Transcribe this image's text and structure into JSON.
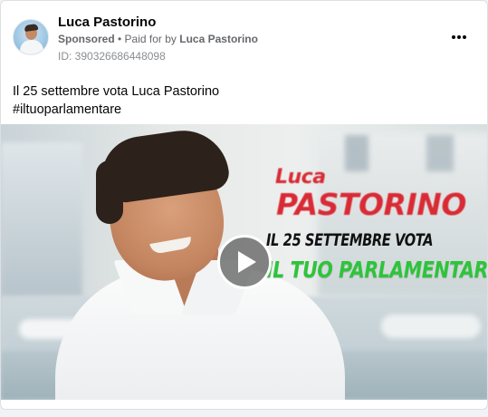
{
  "post": {
    "author_name": "Luca Pastorino",
    "sponsored_label": "Sponsored",
    "separator": " • ",
    "paid_for_prefix": "Paid for by ",
    "paid_for_by": "Luca Pastorino",
    "ad_id_label": "ID: 390326686448098",
    "text_line1": "Il 25 settembre vota Luca Pastorino",
    "hashtag": "#iltuoparlamentare",
    "more_icon": "more-horizontal-icon"
  },
  "media": {
    "overlay_name_small": "Luca",
    "overlay_name_big": "PASTORINO",
    "overlay_line1": "IL 25 SETTEMBRE VOTA",
    "overlay_line2": "IL TUO PARLAMENTARE",
    "play_icon": "play-icon",
    "colors": {
      "name_red": "#d82b35",
      "slogan_green": "#2ec43a"
    }
  }
}
